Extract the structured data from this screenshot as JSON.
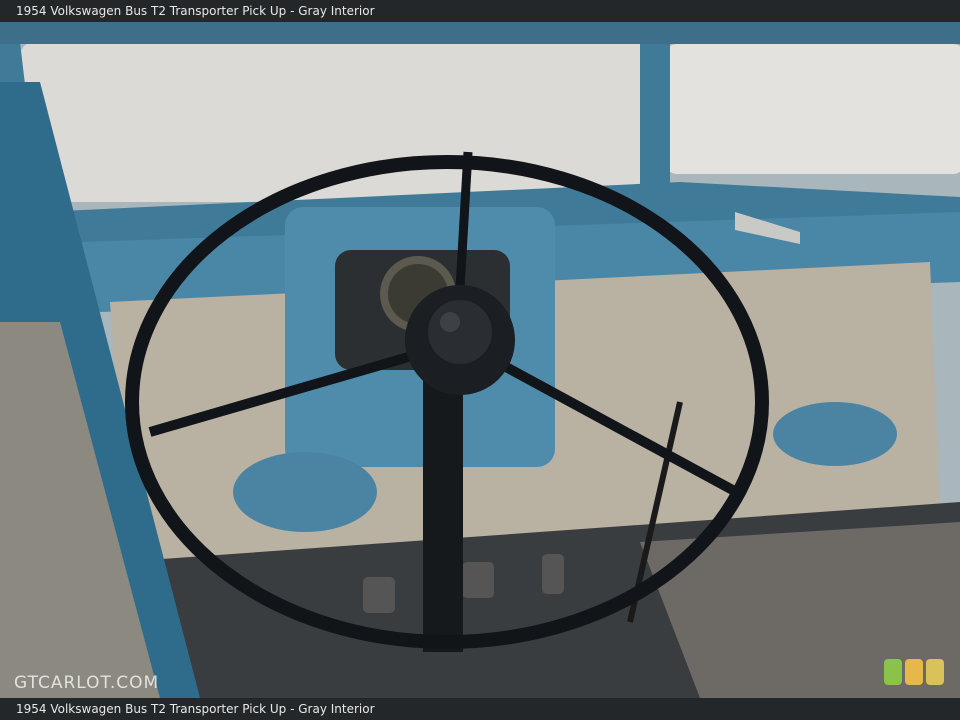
{
  "header": {
    "title": "1954 Volkswagen Bus T2 Transporter Pick Up - Gray Interior"
  },
  "footer": {
    "caption": "1954 Volkswagen Bus T2 Transporter Pick Up - Gray Interior"
  },
  "watermark": {
    "text": "GTCARLOT.COM"
  },
  "swatches": [
    {
      "color": "#8bc34a"
    },
    {
      "color": "#e6b84a"
    },
    {
      "color": "#d9c25a"
    }
  ],
  "colors": {
    "body_blue": "#3f7a99",
    "panel_gray": "#b9b2a3",
    "wheel_black": "#111418"
  }
}
